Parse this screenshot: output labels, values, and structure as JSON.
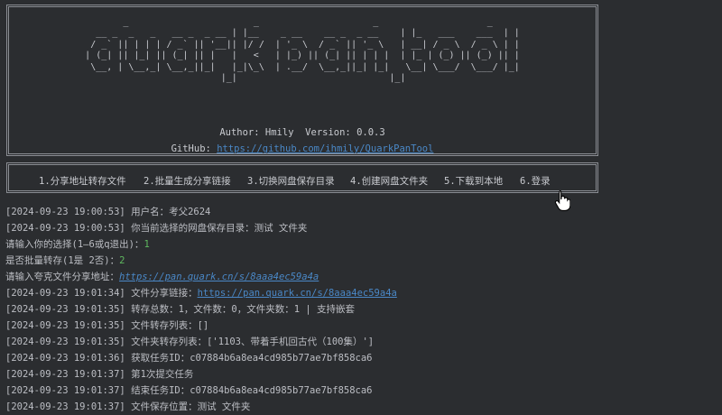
{
  "banner": {
    "ascii_art": "  _                       _                     _                    _\n  __ _  _   _   __ _  _ __ | |__    _ __    __ _  _ __    | |_   ___    ___  | |\n / _` || | | | / _` || '__|| |/ /  | '_ \\  / _` || '_ \\   | __| / _ \\  / _ \\ | |\n| (_| || |_| || (_| || |   |   <   | |_) || (_| || | | |  | |_ | (_) || (_) || |\n \\__, | \\__,_| \\__,_||_|   |_|\\_\\  | .__/  \\__,_||_| |_|   \\__| \\___/  \\___/ |_|\n    |_|                            |_|",
    "author_label": "Author:",
    "author": "Hmily",
    "version_label": "Version:",
    "version": "0.0.3",
    "github_label": "GitHub:",
    "github_url": "https://github.com/ihmily/QuarkPanTool"
  },
  "menu": {
    "items": [
      "1.分享地址转存文件",
      "2.批量生成分享链接",
      "3.切换网盘保存目录",
      "4.创建网盘文件夹",
      "5.下载到本地",
      "6.登录"
    ]
  },
  "log": {
    "l1": "[2024-09-23 19:00:53] 用户名：考父2624",
    "l2": "[2024-09-23 19:00:53] 你当前选择的网盘保存目录：测试 文件夹",
    "l3_prompt": "请输入你的选择(1—6或q退出)：",
    "l3_input": "1",
    "l4_prompt": "是否批量转存(1是 2否)：",
    "l4_input": "2",
    "l5_prompt": "请输入夸克文件分享地址：",
    "l5_url": "https://pan.quark.cn/s/8aaa4ec59a4a",
    "l6_prefix": "[2024-09-23 19:01:34] 文件分享链接：",
    "l6_url": "https://pan.quark.cn/s/8aaa4ec59a4a",
    "l7": "[2024-09-23 19:01:35] 转存总数：1，文件数：0，文件夹数：1 | 支持嵌套",
    "l8": "[2024-09-23 19:01:35] 文件转存列表：[]",
    "l9": "[2024-09-23 19:01:35] 文件夹转存列表：['1103、带着手机回古代（100集）']",
    "l10": "[2024-09-23 19:01:36] 获取任务ID：c07884b6a8ea4cd985b77ae7bf858ca6",
    "l11": "[2024-09-23 19:01:37] 第1次提交任务",
    "l12": "[2024-09-23 19:01:37] 结束任务ID：c07884b6a8ea4cd985b77ae7bf858ca6",
    "l13": "[2024-09-23 19:01:37] 文件保存位置：测试 文件夹"
  },
  "colors": {
    "background": "#2b2d30",
    "text": "#bcbec4",
    "link": "#4a88c7",
    "user_input": "#5fb85f",
    "border": "#8a8d93"
  },
  "icons": {
    "cursor": "hand-pointer-icon"
  }
}
